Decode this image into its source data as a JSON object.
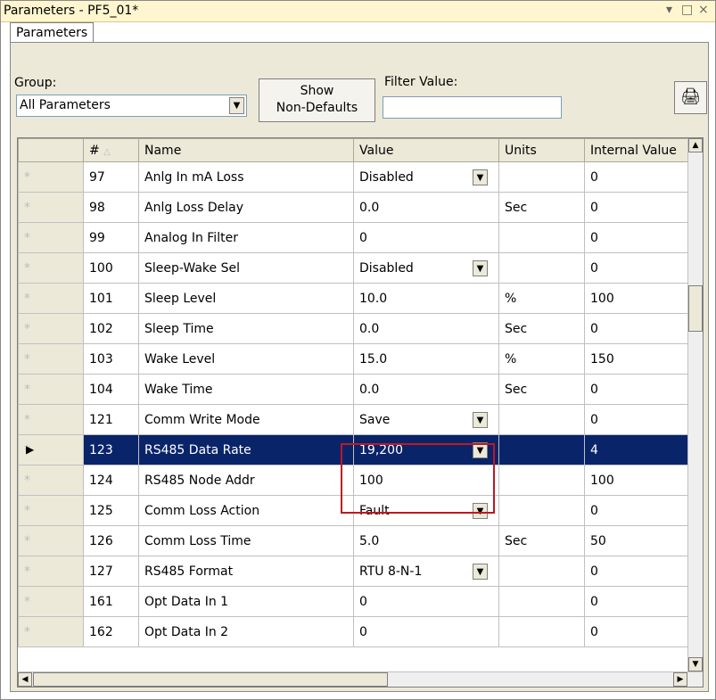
{
  "window": {
    "title": "Parameters - PF5_01*",
    "controls": [
      "▾",
      "□",
      "×"
    ]
  },
  "tab": {
    "label": "Parameters"
  },
  "group": {
    "label": "Group:",
    "value": "All Parameters"
  },
  "show_button": {
    "line1": "Show",
    "line2": "Non-Defaults"
  },
  "filter": {
    "label": "Filter Value:",
    "value": ""
  },
  "columns": {
    "marker": "",
    "num": "#",
    "name": "Name",
    "value": "Value",
    "units": "Units",
    "internal": "Internal Value"
  },
  "rows": [
    {
      "num": "97",
      "name": "Anlg In mA Loss",
      "value": "Disabled",
      "units": "",
      "internal": "0",
      "dropdown": true,
      "star": "*"
    },
    {
      "num": "98",
      "name": "Anlg Loss Delay",
      "value": "0.0",
      "units": "Sec",
      "internal": "0",
      "dropdown": false,
      "star": "*"
    },
    {
      "num": "99",
      "name": "Analog In Filter",
      "value": "0",
      "units": "",
      "internal": "0",
      "dropdown": false,
      "star": "*"
    },
    {
      "num": "100",
      "name": "Sleep-Wake Sel",
      "value": "Disabled",
      "units": "",
      "internal": "0",
      "dropdown": true,
      "star": "*"
    },
    {
      "num": "101",
      "name": "Sleep Level",
      "value": "10.0",
      "units": "%",
      "internal": "100",
      "dropdown": false,
      "star": "*"
    },
    {
      "num": "102",
      "name": "Sleep Time",
      "value": "0.0",
      "units": "Sec",
      "internal": "0",
      "dropdown": false,
      "star": "*"
    },
    {
      "num": "103",
      "name": "Wake Level",
      "value": "15.0",
      "units": "%",
      "internal": "150",
      "dropdown": false,
      "star": "*"
    },
    {
      "num": "104",
      "name": "Wake Time",
      "value": "0.0",
      "units": "Sec",
      "internal": "0",
      "dropdown": false,
      "star": "*"
    },
    {
      "num": "121",
      "name": "Comm Write Mode",
      "value": "Save",
      "units": "",
      "internal": "0",
      "dropdown": true,
      "star": "*"
    },
    {
      "num": "123",
      "name": "RS485 Data Rate",
      "value": "19,200",
      "units": "",
      "internal": "4",
      "dropdown": true,
      "star": "*",
      "selected": true
    },
    {
      "num": "124",
      "name": "RS485 Node Addr",
      "value": "100",
      "units": "",
      "internal": "100",
      "dropdown": false,
      "star": "*"
    },
    {
      "num": "125",
      "name": "Comm Loss Action",
      "value": "Fault",
      "units": "",
      "internal": "0",
      "dropdown": true,
      "star": "*"
    },
    {
      "num": "126",
      "name": "Comm Loss Time",
      "value": "5.0",
      "units": "Sec",
      "internal": "50",
      "dropdown": false,
      "star": "*"
    },
    {
      "num": "127",
      "name": "RS485 Format",
      "value": "RTU 8-N-1",
      "units": "",
      "internal": "0",
      "dropdown": true,
      "star": "*"
    },
    {
      "num": "161",
      "name": "Opt Data In 1",
      "value": "0",
      "units": "",
      "internal": "0",
      "dropdown": false,
      "star": "*"
    },
    {
      "num": "162",
      "name": "Opt Data In 2",
      "value": "0",
      "units": "",
      "internal": "0",
      "dropdown": false,
      "star": "*"
    }
  ],
  "colors": {
    "selection": "#0a246a",
    "highlight": "#c0181f",
    "titlebar": "#fff6cf"
  }
}
